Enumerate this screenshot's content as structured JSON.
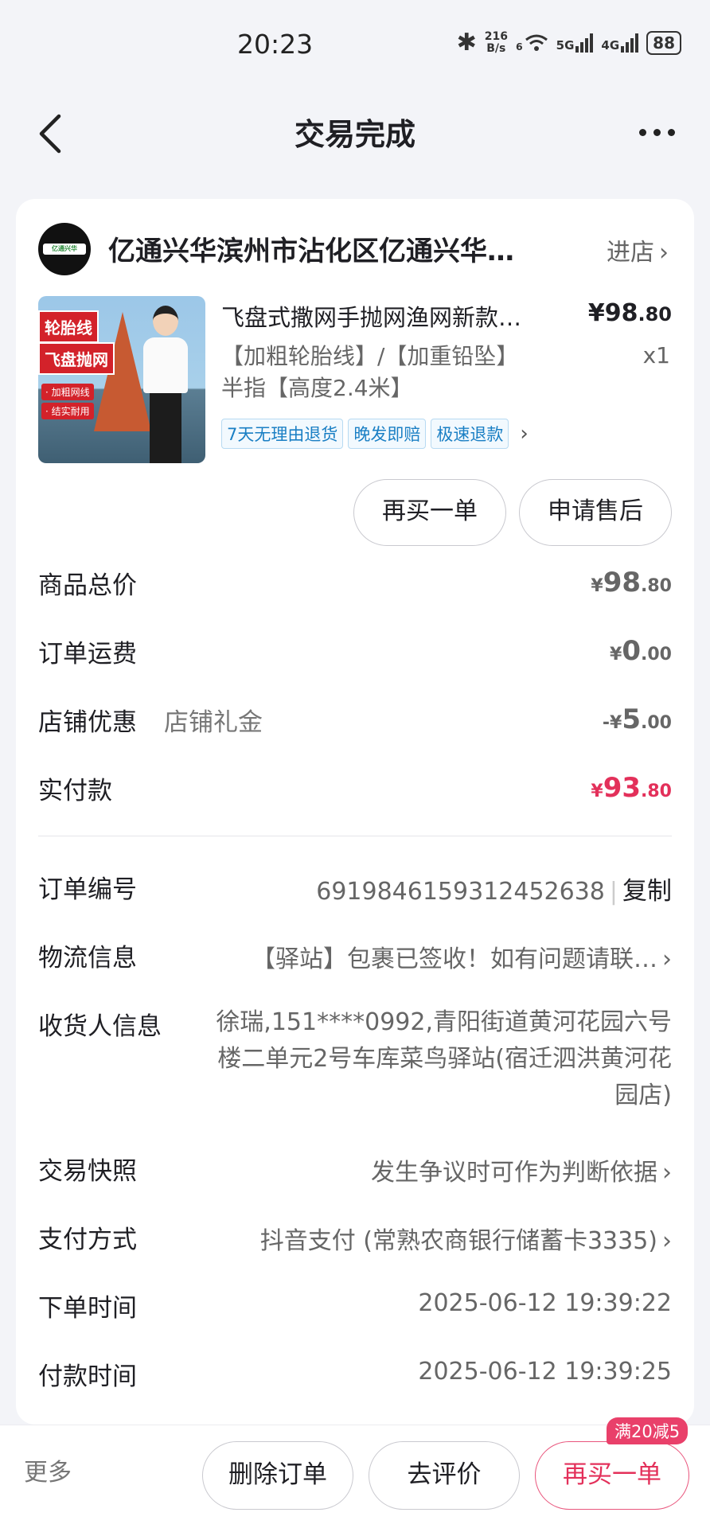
{
  "status_bar": {
    "time": "20:23",
    "net_speed_value": "216",
    "net_speed_unit": "B/s",
    "wifi_badge": "6",
    "sim1": "5G",
    "sim2": "4G",
    "battery": "88",
    "icons": [
      "bluetooth-icon",
      "wifi-icon",
      "signal-icon",
      "battery-icon"
    ]
  },
  "nav": {
    "title": "交易完成",
    "icons": [
      "back-chevron-icon",
      "more-dots-icon"
    ]
  },
  "shop": {
    "name": "亿通兴华滨州市沾化区亿通兴华…",
    "logo_text": "亿通兴华",
    "enter_label": "进店"
  },
  "product": {
    "image_text": {
      "line1": "轮胎线",
      "line2": "飞盘抛网",
      "badge1": "· 加粗网线",
      "badge2": "· 结实耐用"
    },
    "title": "飞盘式撒网手抛网渔网新款…",
    "price_currency": "¥",
    "price_int": "98",
    "price_dec": ".80",
    "spec": "【加粗轮胎线】/【加重铅坠】半指【高度2.4米】",
    "quantity": "x1",
    "tags": [
      "7天无理由退货",
      "晚发即赔",
      "极速退款"
    ]
  },
  "actions": {
    "rebuy": "再买一单",
    "after_sale": "申请售后"
  },
  "price_rows": [
    {
      "label": "商品总价",
      "sign": "",
      "currency": "¥",
      "int": "98",
      "dec": ".80"
    },
    {
      "label": "订单运费",
      "sign": "",
      "currency": "¥",
      "int": "0",
      "dec": ".00"
    },
    {
      "label": "店铺优惠",
      "sublabel": "店铺礼金",
      "sign": "-",
      "currency": "¥",
      "int": "5",
      "dec": ".00"
    },
    {
      "label": "实付款",
      "sign": "",
      "currency": "¥",
      "int": "93",
      "dec": ".80"
    }
  ],
  "order": {
    "number_label": "订单编号",
    "number": "6919846159312452638",
    "copy_label": "复制",
    "logistics_label": "物流信息",
    "logistics": "【驿站】包裹已签收！如有问题请联…",
    "receiver_label": "收货人信息",
    "receiver": "徐瑞,151****0992,青阳街道黄河花园六号楼二单元2号车库菜鸟驿站(宿迁泗洪黄河花园店)",
    "snapshot_label": "交易快照",
    "snapshot": "发生争议时可作为判断依据",
    "payment_label": "支付方式",
    "payment": "抖音支付 (常熟农商银行储蓄卡3335)",
    "order_time_label": "下单时间",
    "order_time": "2025-06-12 19:39:22",
    "pay_time_label": "付款时间",
    "pay_time": "2025-06-12 19:39:25"
  },
  "bottom_bar": {
    "more": "更多",
    "delete": "删除订单",
    "review": "去评价",
    "rebuy": "再买一单",
    "promo": "满20减5"
  },
  "colors": {
    "accent": "#e3305a",
    "tag_blue": "#1a7fc4",
    "background": "#f3f4f8"
  }
}
